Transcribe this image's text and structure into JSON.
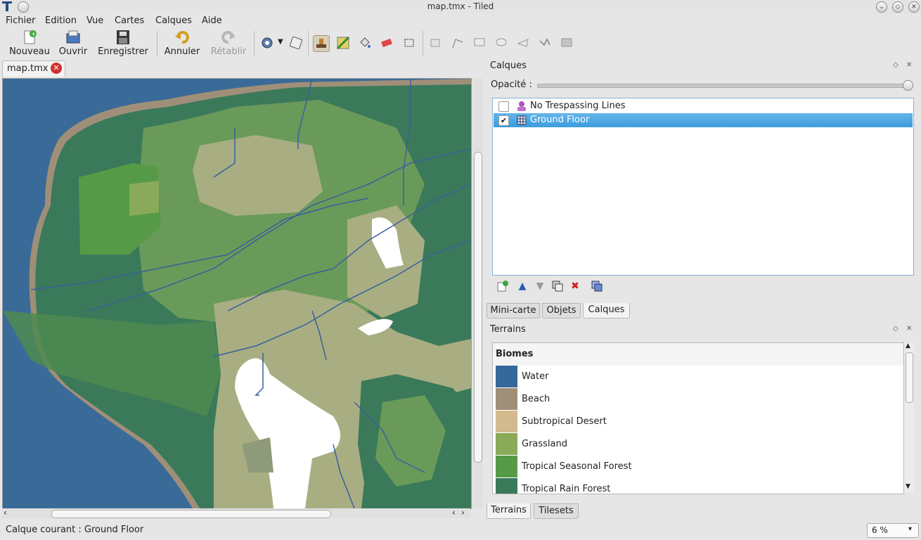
{
  "window": {
    "title": "map.tmx - Tiled"
  },
  "menu": [
    "Fichier",
    "Edition",
    "Vue",
    "Cartes",
    "Calques",
    "Aide"
  ],
  "toolbar": {
    "new": "Nouveau",
    "open": "Ouvrir",
    "save": "Enregistrer",
    "undo": "Annuler",
    "redo": "Rétablir"
  },
  "document": {
    "tab": "map.tmx"
  },
  "layers_dock": {
    "title": "Calques",
    "opacity_label": "Opacité :",
    "opacity": 1.0,
    "layers": [
      {
        "name": "No Trespassing Lines",
        "visible": false,
        "selected": false,
        "type": "object"
      },
      {
        "name": "Ground Floor",
        "visible": true,
        "selected": true,
        "type": "tile"
      }
    ],
    "tabs": [
      "Mini-carte",
      "Objets",
      "Calques"
    ],
    "active_tab": "Calques"
  },
  "terrains_dock": {
    "title": "Terrains",
    "group": "Biomes",
    "terrains": [
      {
        "name": "Water",
        "color": "#36689a"
      },
      {
        "name": "Beach",
        "color": "#a08f78"
      },
      {
        "name": "Subtropical Desert",
        "color": "#d3b98e"
      },
      {
        "name": "Grassland",
        "color": "#8aaa5a"
      },
      {
        "name": "Tropical Seasonal Forest",
        "color": "#569a48"
      },
      {
        "name": "Tropical Rain Forest",
        "color": "#3a7a5a"
      }
    ],
    "tabs": [
      "Terrains",
      "Tilesets"
    ],
    "active_tab": "Terrains"
  },
  "statusbar": {
    "current_layer": "Calque courant : Ground Floor",
    "zoom": "6 %"
  }
}
